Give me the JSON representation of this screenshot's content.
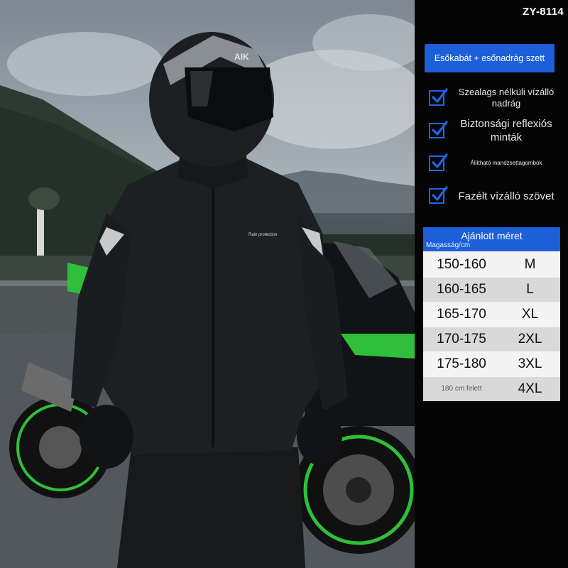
{
  "model_code": "ZY-8114",
  "banner_text": "Esőkabát + esőnadrág szett",
  "features": [
    {
      "text": "Szealags nélküli vízálló nadrág",
      "icon": "checkbox-checked-icon"
    },
    {
      "text": "Biztonsági reflexiós minták",
      "icon": "checkbox-checked-icon"
    },
    {
      "text": "Állítható mandzsettagombok",
      "icon": "checkbox-checked-icon"
    },
    {
      "text": "Fazélt vízálló szövet",
      "icon": "checkbox-checked-icon"
    }
  ],
  "size_table": {
    "title": "Ajánlott méret",
    "column_label": "Magasság/cm",
    "rows": [
      {
        "height": "150-160",
        "size": "M"
      },
      {
        "height": "160-165",
        "size": "L"
      },
      {
        "height": "165-170",
        "size": "XL"
      },
      {
        "height": "170-175",
        "size": "2XL"
      },
      {
        "height": "175-180",
        "size": "3XL"
      },
      {
        "height": "180 cm felett",
        "size": "4XL"
      }
    ]
  },
  "photo": {
    "helmet_brand": "AIK",
    "chest_logo": "Rain protection"
  },
  "colors": {
    "accent_blue": "#1c5fd8",
    "panel_bg": "#050505",
    "table_light": "#f4f4f4",
    "table_dark": "#d9d9d9",
    "bike_green": "#2fbf3a"
  }
}
